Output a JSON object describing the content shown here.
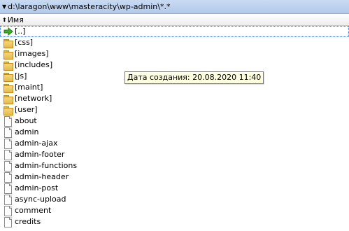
{
  "path_bar": {
    "path": "d:\\laragon\\www\\masteracity\\wp-admin\\*.*"
  },
  "column_header": {
    "name_label": "Имя"
  },
  "rows": [
    {
      "label": "[..]"
    },
    {
      "label": "[css]"
    },
    {
      "label": "[images]"
    },
    {
      "label": "[includes]"
    },
    {
      "label": "[js]"
    },
    {
      "label": "[maint]"
    },
    {
      "label": "[network]"
    },
    {
      "label": "[user]"
    },
    {
      "label": "about"
    },
    {
      "label": "admin"
    },
    {
      "label": "admin-ajax"
    },
    {
      "label": "admin-footer"
    },
    {
      "label": "admin-functions"
    },
    {
      "label": "admin-header"
    },
    {
      "label": "admin-post"
    },
    {
      "label": "async-upload"
    },
    {
      "label": "comment"
    },
    {
      "label": "credits"
    }
  ],
  "tooltip": {
    "text": "Дата создания: 20.08.2020 11:40"
  }
}
